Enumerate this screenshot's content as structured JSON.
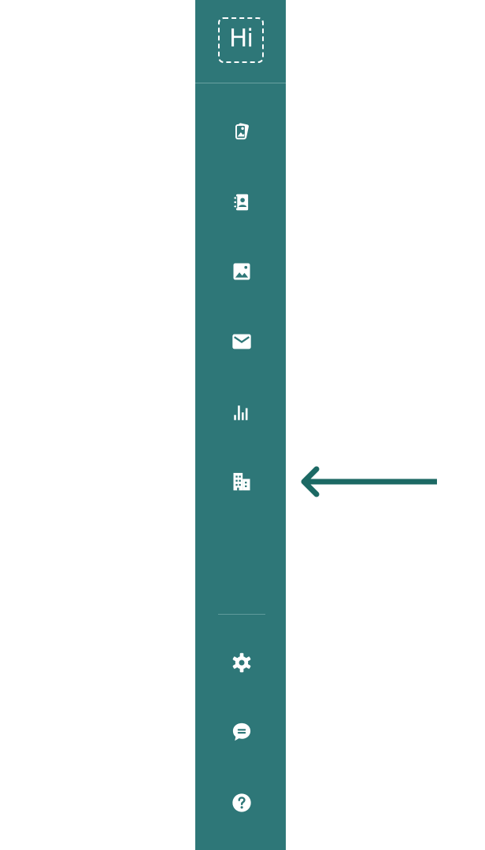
{
  "brand": {
    "logo_text": "Hi",
    "sidebar_color": "#2e7778",
    "icon_color": "#ffffff",
    "arrow_color": "#1c6964"
  },
  "nav": {
    "top_items": [
      {
        "icon": "stacked-photos-icon"
      },
      {
        "icon": "contacts-book-icon"
      },
      {
        "icon": "image-icon"
      },
      {
        "icon": "mail-icon"
      },
      {
        "icon": "bar-chart-icon"
      },
      {
        "icon": "company-building-icon"
      }
    ],
    "bottom_items": [
      {
        "icon": "gear-icon"
      },
      {
        "icon": "chat-bubble-icon"
      },
      {
        "icon": "help-circle-icon"
      }
    ]
  },
  "annotation": {
    "icon": "left-arrow-icon",
    "points_to": "company-building-icon"
  }
}
